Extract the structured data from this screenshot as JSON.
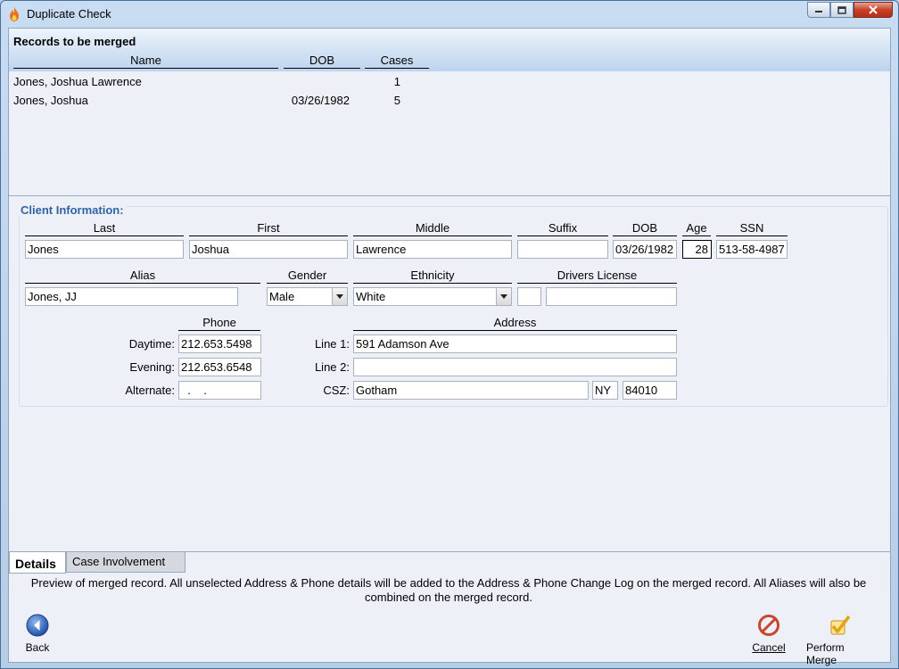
{
  "window": {
    "title": "Duplicate Check"
  },
  "records": {
    "title": "Records to be merged",
    "columns": [
      "Name",
      "DOB",
      "Cases"
    ],
    "rows": [
      {
        "name": "Jones, Joshua Lawrence",
        "dob": "",
        "cases": "1"
      },
      {
        "name": "Jones, Joshua",
        "dob": "03/26/1982",
        "cases": "5"
      }
    ]
  },
  "client": {
    "section_title": "Client Information:",
    "labels": {
      "last": "Last",
      "first": "First",
      "middle": "Middle",
      "suffix": "Suffix",
      "dob": "DOB",
      "age": "Age",
      "ssn": "SSN",
      "alias": "Alias",
      "gender": "Gender",
      "ethnicity": "Ethnicity",
      "drivers_license": "Drivers License",
      "phone": "Phone",
      "address": "Address",
      "daytime": "Daytime:",
      "evening": "Evening:",
      "alternate": "Alternate:",
      "line1": "Line 1:",
      "line2": "Line 2:",
      "csz": "CSZ:"
    },
    "values": {
      "last": "Jones",
      "first": "Joshua",
      "middle": "Lawrence",
      "suffix": "",
      "dob": "03/26/1982",
      "age": "28",
      "ssn": "513-58-4987",
      "alias": "Jones, JJ",
      "gender": "Male",
      "ethnicity": "White",
      "dl_state": "",
      "dl_number": "",
      "daytime": "212.653.5498",
      "evening": "212.653.6548",
      "alternate": "  .    .",
      "line1": "591 Adamson Ave",
      "line2": "",
      "city": "Gotham",
      "state": "NY",
      "zip": "84010"
    }
  },
  "tabs": [
    {
      "label": "Details",
      "active": true
    },
    {
      "label": "Case Involvement",
      "active": false
    }
  ],
  "notice": "Preview of merged record.  All unselected Address & Phone details will be added to the Address & Phone Change Log on the merged record. All Aliases will also be combined on the merged record.",
  "actions": {
    "back": "Back",
    "cancel": "Cancel",
    "perform_merge": "Perform Merge"
  },
  "colors": {
    "section_title": "#2e64a6",
    "header_gradient_bottom": "#bcd3ee",
    "close_button": "#c7432a"
  }
}
